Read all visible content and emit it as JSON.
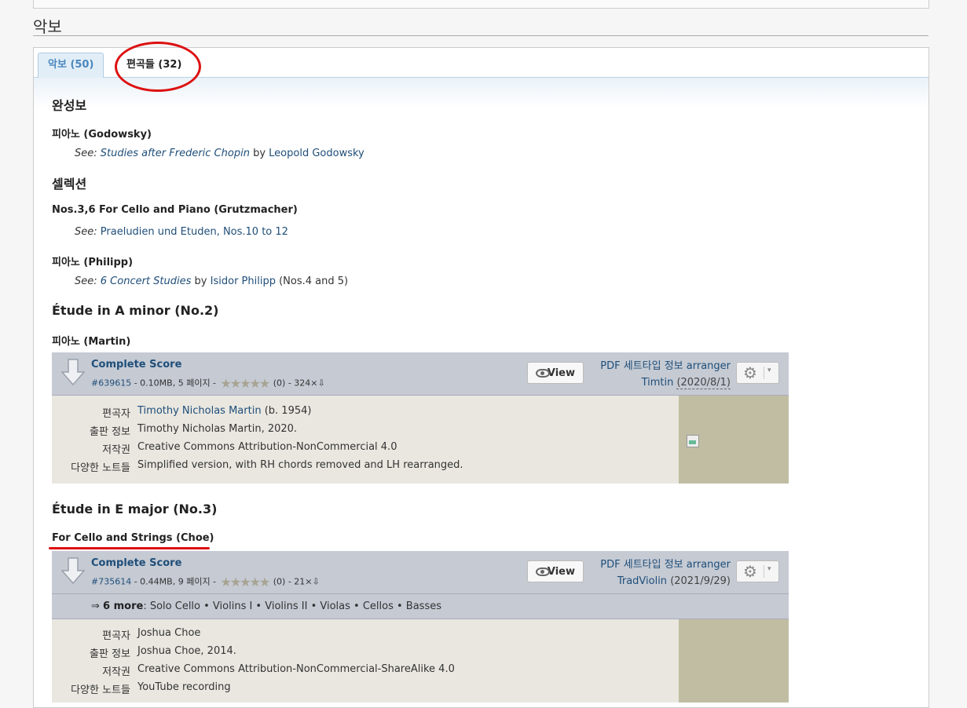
{
  "section": {
    "title": "악보"
  },
  "tabs": [
    {
      "label": "악보 (50)",
      "active": true
    },
    {
      "label": "편곡들 (32)",
      "active": false
    }
  ],
  "content": {
    "complete_heading": "완성보",
    "piano_godowsky": {
      "heading": "피아노 (Godowsky)",
      "see": "See:",
      "link": "Studies after Frederic Chopin",
      "by": "by",
      "author": "Leopold Godowsky"
    },
    "selection_heading": "셀렉션",
    "cello_grutzmacher": {
      "heading": "Nos.3,6 For Cello and Piano (Grutzmacher)",
      "see": "See:",
      "link": "Praeludien und Etuden, Nos.10 to 12"
    },
    "piano_philipp": {
      "heading": "피아노 (Philipp)",
      "see": "See:",
      "link": "6 Concert Studies",
      "by": "by",
      "author": "Isidor Philipp",
      "note": "(Nos.4 and 5)"
    },
    "etude_a_minor": {
      "heading": "Étude in A minor (No.2)",
      "sub": "피아노 (Martin)"
    },
    "etude_e_major": {
      "heading": "Étude in E major (No.3)",
      "sub": "For Cello and Strings (Choe)"
    }
  },
  "files": [
    {
      "name": "Complete Score",
      "id": "#639615",
      "meta": " - 0.10MB, 5 페이지 - ",
      "rating": "(0) - 324×",
      "view": "View",
      "info_line1": "PDF 세트타입 정보 arranger",
      "uploader": "Timtin",
      "date": "(2020/8/1)",
      "details": [
        {
          "key": "편곡자",
          "value": "Timothy Nicholas Martin",
          "extra": " (b. 1954)"
        },
        {
          "key": "출판 정보",
          "value": "Timothy Nicholas Martin, 2020.",
          "extra": ""
        },
        {
          "key": "저작권",
          "value": "Creative Commons Attribution-NonCommercial 4.0",
          "extra": ""
        },
        {
          "key": "다양한 노트들",
          "value": "Simplified version, with RH chords removed and LH rearranged.",
          "extra": ""
        }
      ]
    },
    {
      "name": "Complete Score",
      "id": "#735614",
      "meta": " - 0.44MB, 9 페이지 - ",
      "rating": "(0) - 21×",
      "view": "View",
      "info_line1": "PDF 세트타입 정보 arranger",
      "uploader": "TradViolin",
      "date": "(2021/9/29)",
      "more_arrow": "⇒",
      "more_label": "6 more",
      "more_parts": ": Solo Cello • Violins I • Violins II • Violas • Cellos • Basses",
      "details": [
        {
          "key": "편곡자",
          "value": "Joshua Choe",
          "extra": ""
        },
        {
          "key": "출판 정보",
          "value": "Joshua Choe, 2014.",
          "extra": ""
        },
        {
          "key": "저작권",
          "value": "Creative Commons Attribution-NonCommercial-ShareAlike 4.0",
          "extra": ""
        },
        {
          "key": "다양한 노트들",
          "value": "YouTube recording",
          "extra": ""
        }
      ]
    }
  ],
  "colors": {
    "accent_link": "#1f4e79",
    "tab_active": "#4a87bd",
    "annotation_red": "#dd1111"
  }
}
